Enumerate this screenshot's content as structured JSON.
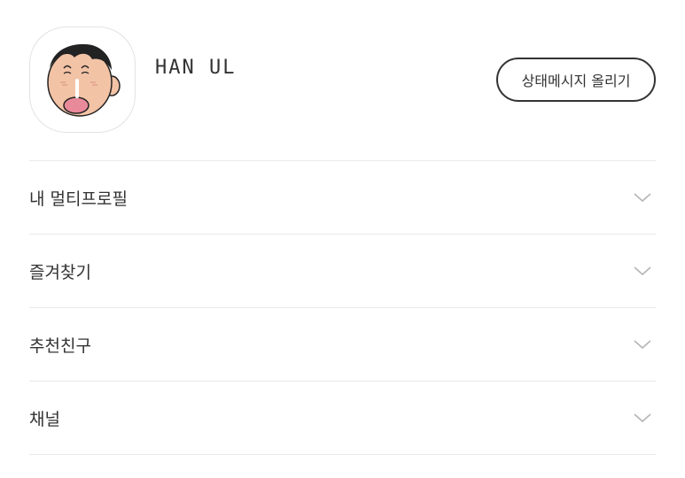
{
  "profile": {
    "name": "HAN UL",
    "status_button_label": "상태메시지 올리기",
    "avatar_icon": "cartoon-face-avatar"
  },
  "menu": {
    "items": [
      {
        "label": "내 멀티프로필",
        "icon": "chevron-down-icon"
      },
      {
        "label": "즐겨찾기",
        "icon": "chevron-down-icon"
      },
      {
        "label": "추천친구",
        "icon": "chevron-down-icon"
      },
      {
        "label": "채널",
        "icon": "chevron-down-icon"
      }
    ]
  },
  "colors": {
    "text": "#333333",
    "divider": "#e9e9e9",
    "chevron": "#b5b5b5",
    "avatar_skin": "#f3c3a6",
    "avatar_mouth": "#e98a9b",
    "avatar_hair": "#222222"
  }
}
